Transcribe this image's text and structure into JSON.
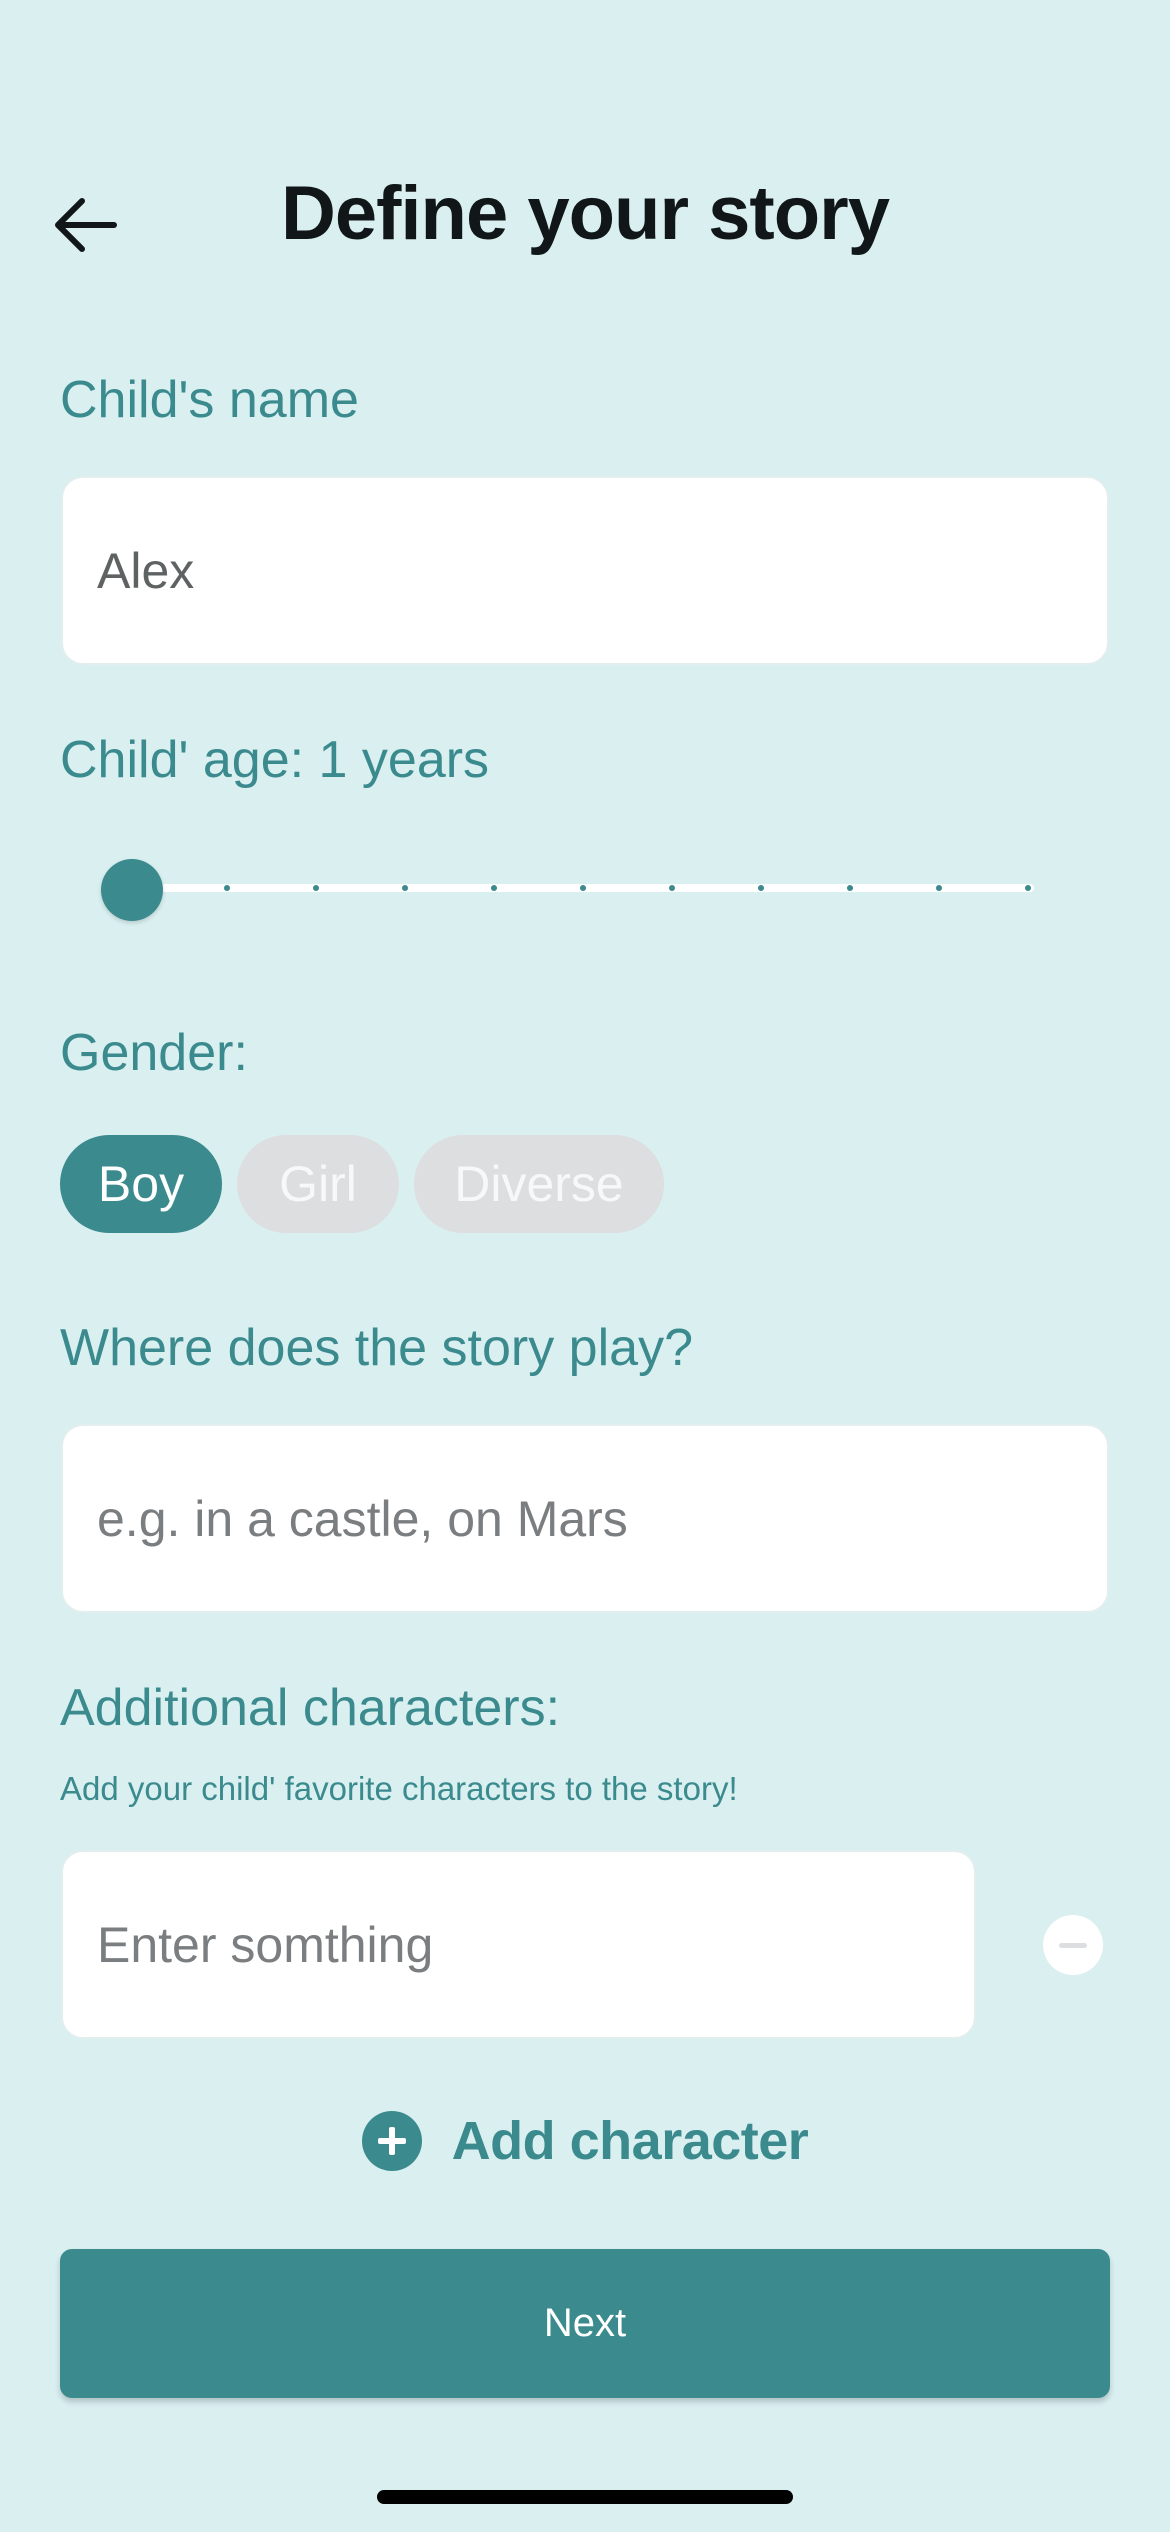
{
  "header": {
    "title": "Define your story",
    "back_icon": "arrow-left-icon"
  },
  "name_section": {
    "label": "Child's name",
    "value": "Alex"
  },
  "age_section": {
    "label": "Child' age: 1 years",
    "slider": {
      "min": 1,
      "max": 11,
      "value": 1,
      "steps": 11
    }
  },
  "gender_section": {
    "label": "Gender:",
    "options": [
      {
        "label": "Boy",
        "selected": true
      },
      {
        "label": "Girl",
        "selected": false
      },
      {
        "label": "Diverse",
        "selected": false
      }
    ]
  },
  "location_section": {
    "label": "Where does the story play?",
    "placeholder": "e.g. in a castle, on Mars"
  },
  "characters_section": {
    "label": "Additional characters:",
    "hint": "Add your child' favorite characters to the story!",
    "entry_placeholder": "Enter somthing",
    "remove_icon": "minus-circle-icon",
    "add_icon": "plus-circle-icon",
    "add_label": "Add character"
  },
  "footer": {
    "next_label": "Next"
  },
  "colors": {
    "background": "#d9eff0",
    "accent": "#3a8a8e",
    "chip_inactive": "#dcdedf",
    "title": "#111618"
  }
}
